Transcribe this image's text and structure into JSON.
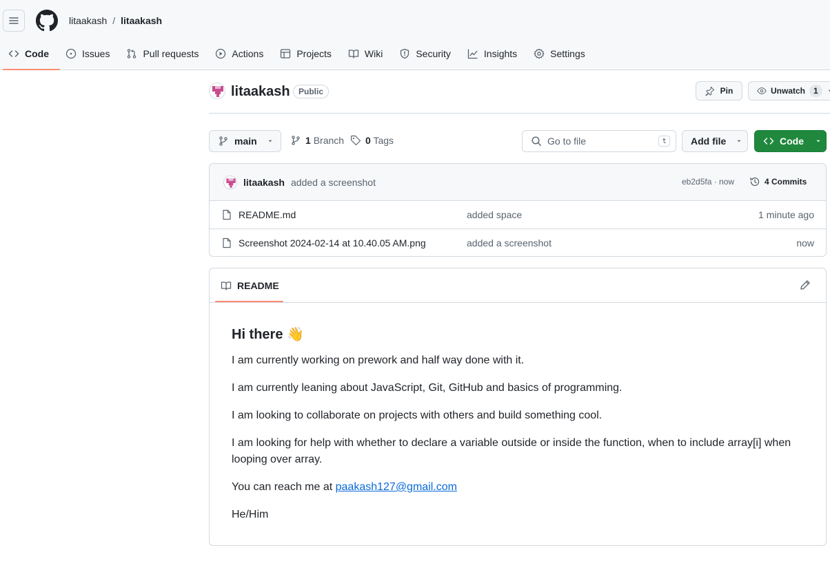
{
  "header": {
    "owner": "litaakash",
    "separator": "/",
    "repo": "litaakash"
  },
  "nav": [
    {
      "label": "Code",
      "icon": "code-icon",
      "active": true
    },
    {
      "label": "Issues",
      "icon": "issue-icon"
    },
    {
      "label": "Pull requests",
      "icon": "pull-request-icon"
    },
    {
      "label": "Actions",
      "icon": "play-icon"
    },
    {
      "label": "Projects",
      "icon": "table-icon"
    },
    {
      "label": "Wiki",
      "icon": "book-icon"
    },
    {
      "label": "Security",
      "icon": "shield-icon"
    },
    {
      "label": "Insights",
      "icon": "graph-icon"
    },
    {
      "label": "Settings",
      "icon": "gear-icon"
    }
  ],
  "repo": {
    "title": "litaakash",
    "visibility": "Public",
    "pin_label": "Pin",
    "unwatch_label": "Unwatch",
    "watch_count": "1"
  },
  "branch_bar": {
    "branch": "main",
    "branch_count": "1",
    "branch_label": "Branch",
    "tag_count": "0",
    "tag_label": "Tags",
    "goto_placeholder": "Go to file",
    "goto_shortcut": "t",
    "add_file_label": "Add file",
    "code_label": "Code"
  },
  "latest_commit": {
    "author": "litaakash",
    "message": "added a screenshot",
    "hash_time": "eb2d5fa · now",
    "commits_label": "4 Commits"
  },
  "files": [
    {
      "name": "README.md",
      "message": "added space",
      "age": "1 minute ago"
    },
    {
      "name": "Screenshot 2024-02-14 at 10.40.05 AM.png",
      "message": "added a screenshot",
      "age": "now"
    }
  ],
  "readme": {
    "tab_label": "README",
    "heading": "Hi there 👋",
    "p1": "I am currently working on prework and half way done with it.",
    "p2": "I am currently leaning about JavaScript, Git, GitHub and basics of programming.",
    "p3": "I am looking to collaborate on projects with others and build something cool.",
    "p4": "I am looking for help with whether to declare a variable outside or inside the function, when to include array[i] when looping over array.",
    "p5_prefix": "You can reach me at ",
    "email": "paakash127@gmail.com",
    "p6": "He/Him"
  },
  "colors": {
    "accent_underline": "#fd8c73",
    "code_button": "#1f883d",
    "link": "#0969da",
    "avatar": "#c74d8f"
  }
}
